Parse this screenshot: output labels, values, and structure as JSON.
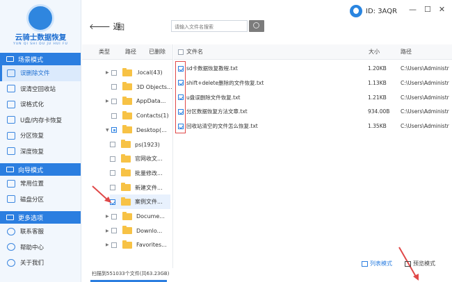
{
  "app": {
    "name": "云骑士数据恢复",
    "subtitle": "YUN QI SHI DU JU HUI FU",
    "account_id": "ID: 3AQR"
  },
  "window": {
    "minimize": "—",
    "maximize": "☐",
    "close": "✕"
  },
  "sidebar": {
    "modes": [
      {
        "label": "场景模式",
        "items": [
          {
            "label": "误删除文件",
            "active": true
          },
          {
            "label": "误清空回收站"
          },
          {
            "label": "误格式化"
          },
          {
            "label": "U盘/内存卡恢复"
          },
          {
            "label": "分区恢复"
          },
          {
            "label": "深度恢复"
          }
        ]
      },
      {
        "label": "向导模式",
        "items": [
          {
            "label": "常用位置"
          },
          {
            "label": "磁盘分区"
          }
        ]
      },
      {
        "label": "更多选项",
        "items": [
          {
            "label": "联系客服"
          },
          {
            "label": "帮助中心"
          },
          {
            "label": "关于我们"
          }
        ]
      }
    ]
  },
  "toolbar": {
    "back_label": "返",
    "up_label": "回",
    "search_placeholder": "请输入文件名搜索"
  },
  "tree": {
    "headers": [
      "类型",
      "路径",
      "已删除"
    ],
    "rows": [
      {
        "label": ".local(43)",
        "expand": "▶",
        "indent": 1
      },
      {
        "label": "3D Objects...",
        "expand": "",
        "indent": 1
      },
      {
        "label": "AppData...",
        "expand": "▶",
        "indent": 1
      },
      {
        "label": "Contacts(1)",
        "expand": "",
        "indent": 1
      },
      {
        "label": "Desktop(...",
        "expand": "▼",
        "indent": 1,
        "state": "partial"
      },
      {
        "label": "ps(1923)",
        "expand": "",
        "indent": 2
      },
      {
        "label": "官网收文...",
        "expand": "",
        "indent": 2
      },
      {
        "label": "批量修改...",
        "expand": "",
        "indent": 2
      },
      {
        "label": "新建文件...",
        "expand": "",
        "indent": 2
      },
      {
        "label": "案例文件...",
        "expand": "",
        "indent": 2,
        "state": "checked",
        "selected": true
      },
      {
        "label": "Docume...",
        "expand": "▶",
        "indent": 1
      },
      {
        "label": "Downlo...",
        "expand": "▶",
        "indent": 1
      },
      {
        "label": "Favorites...",
        "expand": "▶",
        "indent": 1
      }
    ]
  },
  "files": {
    "headers": {
      "name": "文件名",
      "size": "大小",
      "path": "路径"
    },
    "rows": [
      {
        "name": "sd卡数据恢复教程.txt",
        "size": "1.20KB",
        "path": "C:\\Users\\Administr"
      },
      {
        "name": "shift+delete删除的文件恢复.txt",
        "size": "1.13KB",
        "path": "C:\\Users\\Administr"
      },
      {
        "name": "u盘误删除文件恢复.txt",
        "size": "1.21KB",
        "path": "C:\\Users\\Administr"
      },
      {
        "name": "分区数据恢复方法文章.txt",
        "size": "934.00B",
        "path": "C:\\Users\\Administr"
      },
      {
        "name": "回收站清空的文件怎么恢复.txt",
        "size": "1.35KB",
        "path": "C:\\Users\\Administr"
      }
    ]
  },
  "status": {
    "scan_text": "扫描到551033个文件(共63.23GB)"
  },
  "views": {
    "list": "列表模式",
    "preview": "预览模式"
  },
  "colors": {
    "accent": "#2b7ee0",
    "annotation": "#e04848",
    "folder": "#f7c245"
  }
}
